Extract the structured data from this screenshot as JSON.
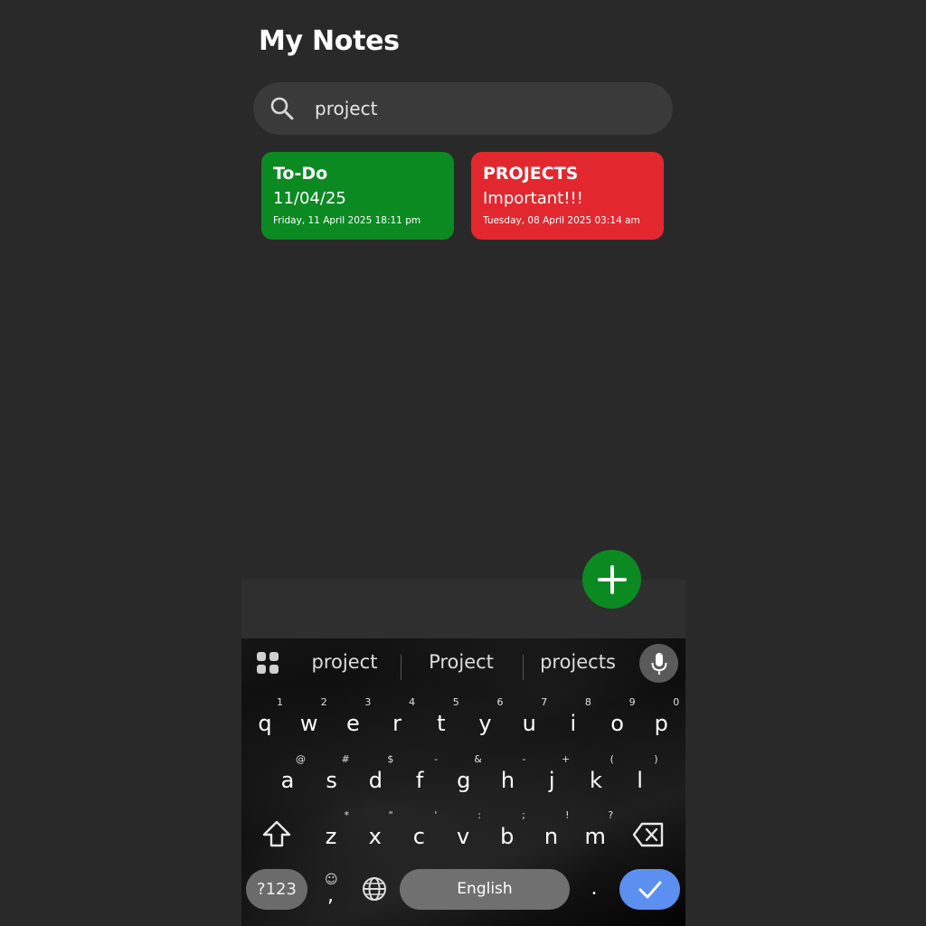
{
  "app": {
    "title": "My Notes"
  },
  "search": {
    "value": "project",
    "icon": "search-icon"
  },
  "notes": [
    {
      "title": "To-Do",
      "body": "11/04/25",
      "timestamp": "Friday, 11 April 2025 18:11 pm",
      "color": "#0b8a22"
    },
    {
      "title": "PROJECTS",
      "body": "Important!!!",
      "timestamp": "Tuesday, 08 April 2025 03:14 am",
      "color": "#e2282e"
    }
  ],
  "fab": {
    "icon": "plus-icon",
    "color": "#0b8a22"
  },
  "keyboard": {
    "suggestions": [
      "project",
      "Project",
      "projects"
    ],
    "row1": [
      {
        "key": "q",
        "hint": "1"
      },
      {
        "key": "w",
        "hint": "2"
      },
      {
        "key": "e",
        "hint": "3"
      },
      {
        "key": "r",
        "hint": "4"
      },
      {
        "key": "t",
        "hint": "5"
      },
      {
        "key": "y",
        "hint": "6"
      },
      {
        "key": "u",
        "hint": "7"
      },
      {
        "key": "i",
        "hint": "8"
      },
      {
        "key": "o",
        "hint": "9"
      },
      {
        "key": "p",
        "hint": "0"
      }
    ],
    "row2": [
      {
        "key": "a",
        "hint": "@"
      },
      {
        "key": "s",
        "hint": "#"
      },
      {
        "key": "d",
        "hint": "$"
      },
      {
        "key": "f",
        "hint": "-"
      },
      {
        "key": "g",
        "hint": "&"
      },
      {
        "key": "h",
        "hint": "-"
      },
      {
        "key": "j",
        "hint": "+"
      },
      {
        "key": "k",
        "hint": "("
      },
      {
        "key": "l",
        "hint": ")"
      }
    ],
    "row3": [
      {
        "key": "z",
        "hint": "*"
      },
      {
        "key": "x",
        "hint": "\""
      },
      {
        "key": "c",
        "hint": "'"
      },
      {
        "key": "v",
        "hint": ":"
      },
      {
        "key": "b",
        "hint": ";"
      },
      {
        "key": "n",
        "hint": "!"
      },
      {
        "key": "m",
        "hint": "?"
      }
    ],
    "symbols_label": "?123",
    "comma_label": ",",
    "space_label": "English",
    "period_label": ".",
    "colors": {
      "enter": "#5b8ff0",
      "space": "#707070",
      "symbols": "#6b6b6b"
    }
  }
}
